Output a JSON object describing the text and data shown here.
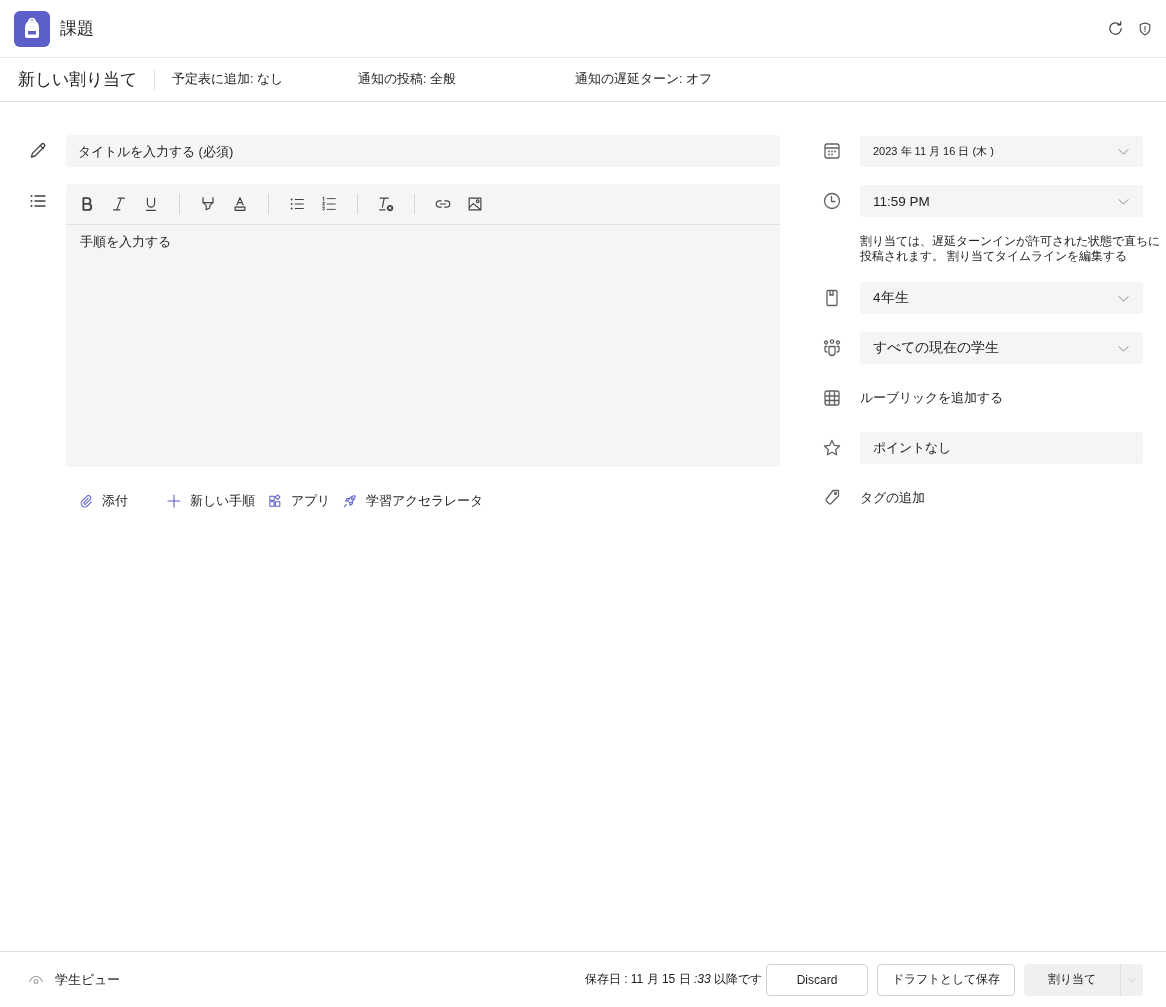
{
  "app": {
    "title": "課題"
  },
  "assignment_bar": {
    "title": "新しい割り当て",
    "settings": [
      "予定表に追加: なし",
      "通知の投稿: 全般",
      "通知の遅延ターン: オフ"
    ]
  },
  "editor": {
    "title_field": {
      "placeholder": "タイトルを入力する (必須)"
    },
    "toolbar_groups": [
      {
        "tools": [
          {
            "kind": "bold"
          },
          {
            "kind": "italic"
          },
          {
            "kind": "underline"
          }
        ]
      },
      {
        "tools": [
          {
            "kind": "highlight"
          },
          {
            "kind": "font_color"
          }
        ]
      },
      {
        "tools": [
          {
            "kind": "bulleted_list"
          },
          {
            "kind": "numbered_list"
          }
        ]
      },
      {
        "tools": [
          {
            "kind": "clear_formatting"
          }
        ]
      },
      {
        "tools": [
          {
            "kind": "link"
          },
          {
            "kind": "image"
          }
        ]
      }
    ],
    "instructions_field": {
      "placeholder": "手順を入力する"
    }
  },
  "attach_actions": [
    {
      "kind": "attach",
      "label": "添付"
    },
    {
      "kind": "new_instructions",
      "label": "新しい手順"
    },
    {
      "kind": "apps",
      "label": "アプリ"
    },
    {
      "kind": "learning_accelerator",
      "label": "学習アクセラレータ"
    }
  ],
  "details": [
    {
      "kind": "due_date",
      "value": "2023 年 11 月 16 日 (木 )"
    },
    {
      "kind": "due_time",
      "value": "11:59 PM",
      "note": "割り当ては、遅延ターンインが許可された状態で直ちに投稿されます。 割り当てタイムラインを編集する"
    },
    {
      "kind": "class",
      "value": "4年生"
    },
    {
      "kind": "students",
      "value": "すべての現在の学生"
    },
    {
      "kind": "rubric",
      "label": "ルーブリックを追加する"
    },
    {
      "kind": "points",
      "value": "ポイントなし"
    },
    {
      "kind": "tags",
      "label": "タグの追加"
    }
  ],
  "footer": {
    "student_view": "学生ビュー",
    "saved_status": "保存日 : 11 月 15 日 *:33* 以降です",
    "buttons": [
      {
        "kind": "outline",
        "label": "Discard"
      },
      {
        "kind": "outline",
        "label": "ドラフトとして保存"
      },
      {
        "kind": "split",
        "label": "割り当て"
      }
    ]
  }
}
